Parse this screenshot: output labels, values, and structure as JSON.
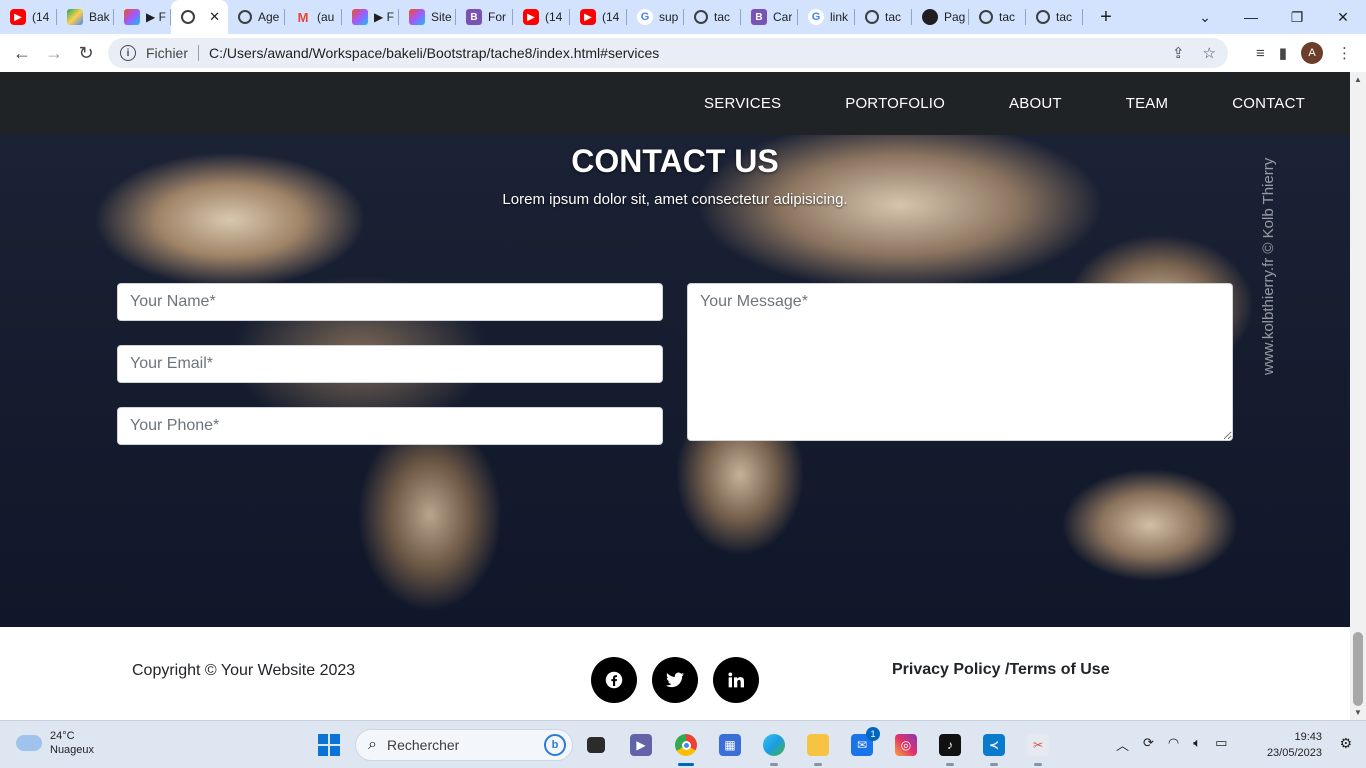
{
  "browser": {
    "tabs": [
      {
        "label": "(14",
        "icon": "youtube-icon"
      },
      {
        "label": "Bak",
        "icon": "drive-icon"
      },
      {
        "label": "▶ F",
        "icon": "figma-icon"
      },
      {
        "label": "",
        "icon": "globe-icon",
        "active": true
      },
      {
        "label": "Age",
        "icon": "globe-icon"
      },
      {
        "label": "(au",
        "icon": "gmail-icon"
      },
      {
        "label": "▶ F",
        "icon": "figma-icon"
      },
      {
        "label": "Site",
        "icon": "figma-icon"
      },
      {
        "label": "For",
        "icon": "bootstrap-icon"
      },
      {
        "label": "(14",
        "icon": "youtube-icon"
      },
      {
        "label": "(14",
        "icon": "youtube-icon"
      },
      {
        "label": "sup",
        "icon": "google-icon"
      },
      {
        "label": "tac",
        "icon": "globe-icon"
      },
      {
        "label": "Car",
        "icon": "bootstrap-icon"
      },
      {
        "label": "link",
        "icon": "google-icon"
      },
      {
        "label": "tac",
        "icon": "globe-icon"
      },
      {
        "label": "Pag",
        "icon": "github-icon"
      },
      {
        "label": "tac",
        "icon": "globe-icon"
      },
      {
        "label": "tac",
        "icon": "globe-icon"
      }
    ],
    "address": {
      "scheme_label": "Fichier",
      "url": "C:/Users/awand/Workspace/bakeli/Bootstrap/tache8/index.html#services"
    },
    "profile_initial": "A"
  },
  "site": {
    "nav": [
      "SERVICES",
      "PORTOFOLIO",
      "ABOUT",
      "TEAM",
      "CONTACT"
    ],
    "contact": {
      "title": "CONTACT US",
      "subtitle": "Lorem ipsum dolor sit, amet consectetur adipisicing.",
      "name_placeholder": "Your Name*",
      "email_placeholder": "Your Email*",
      "phone_placeholder": "Your Phone*",
      "message_placeholder": "Your Message*",
      "watermark": "www.kolbthierry.fr © Kolb Thierry"
    },
    "footer": {
      "copyright": "Copyright © Your Website 2023",
      "legal": "Privacy Policy /Terms of Use",
      "social": [
        "facebook-icon",
        "twitter-icon",
        "linkedin-icon"
      ]
    }
  },
  "taskbar": {
    "weather_temp": "24°C",
    "weather_desc": "Nuageux",
    "search_placeholder": "Rechercher",
    "time": "19:43",
    "date": "23/05/2023",
    "mail_badge": "1"
  },
  "colors": {
    "navbar_bg": "#1f2326",
    "tab_strip": "#d3e3fd",
    "taskbar": "#dee6f2"
  }
}
